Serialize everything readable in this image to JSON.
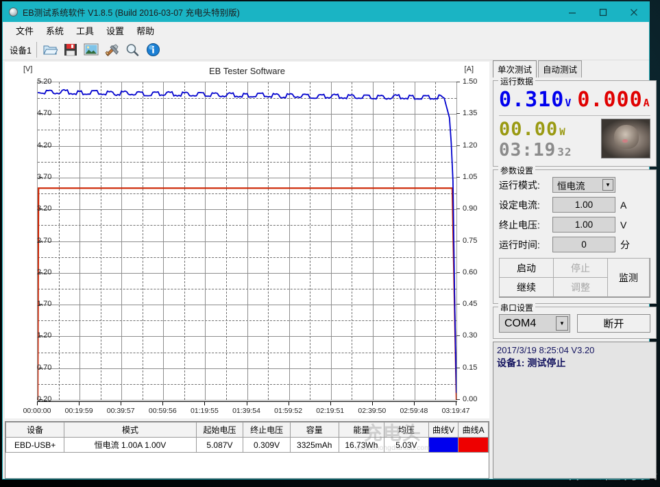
{
  "window": {
    "title": "EB测试系统软件 V1.8.5 (Build 2016-03-07 充电头特别版)",
    "app_icon": "sphere-icon",
    "minimize": "–",
    "maximize": "□",
    "close": "✕",
    "titlebar_color": "#1ab4c4"
  },
  "menubar": {
    "items": [
      {
        "label": "文件",
        "name": "menu-file"
      },
      {
        "label": "系统",
        "name": "menu-system"
      },
      {
        "label": "工具",
        "name": "menu-tools"
      },
      {
        "label": "设置",
        "name": "menu-settings"
      },
      {
        "label": "帮助",
        "name": "menu-help"
      }
    ]
  },
  "toolbar": {
    "device_label": "设备1",
    "buttons": [
      {
        "name": "open-folder-icon"
      },
      {
        "name": "save-floppy-icon"
      },
      {
        "name": "picture-icon"
      },
      {
        "name": "tools-icon"
      },
      {
        "name": "magnifier-icon"
      },
      {
        "name": "info-icon"
      }
    ]
  },
  "chart_data": {
    "type": "line",
    "title": "EB Tester Software",
    "xlabel": "",
    "ylabel": "[V]",
    "y2label": "[A]",
    "grid": true,
    "legend": "none",
    "ylim": [
      0.2,
      5.2
    ],
    "y2lim": [
      0.0,
      1.5
    ],
    "yticks": [
      "0.20",
      "0.70",
      "1.20",
      "1.70",
      "2.20",
      "2.70",
      "3.20",
      "3.70",
      "4.20",
      "4.70",
      "5.20"
    ],
    "y2ticks": [
      "0.00",
      "0.15",
      "0.30",
      "0.45",
      "0.60",
      "0.75",
      "0.90",
      "1.05",
      "1.20",
      "1.35",
      "1.50"
    ],
    "xticks": [
      "00:00:00",
      "00:19:59",
      "00:39:57",
      "00:59:56",
      "01:19:55",
      "01:39:54",
      "01:59:52",
      "02:19:51",
      "02:39:50",
      "02:59:48",
      "03:19:47"
    ],
    "xlim": [
      "00:00:00",
      "03:19:47"
    ],
    "series": [
      {
        "name": "曲线V",
        "axis": "left",
        "color": "#0000cd",
        "unit": "V",
        "description": "Voltage slowly declining with sawtooth ripple, collapsing at end of test",
        "x_pct": [
          0,
          2,
          6,
          10,
          14,
          18,
          22,
          26,
          30,
          34,
          38,
          42,
          46,
          50,
          54,
          58,
          62,
          66,
          70,
          74,
          78,
          82,
          86,
          90,
          94,
          97,
          98.5,
          99.2,
          99.6,
          100
        ],
        "values": [
          5.06,
          5.04,
          5.05,
          5.03,
          5.04,
          5.02,
          5.03,
          5.01,
          5.02,
          5.01,
          5.01,
          5.0,
          5.0,
          4.99,
          5.0,
          4.98,
          4.99,
          4.97,
          4.98,
          4.97,
          4.97,
          4.96,
          4.97,
          4.96,
          4.96,
          4.97,
          4.6,
          3.6,
          1.6,
          0.31
        ]
      },
      {
        "name": "曲线A",
        "axis": "right",
        "color": "#cc2200",
        "unit": "A",
        "description": "Constant current 1.00 A for whole run, drops to 0 at end",
        "x_pct": [
          0,
          0.2,
          1,
          50,
          98,
          99,
          99.5,
          100
        ],
        "values": [
          0.0,
          1.0,
          1.0,
          1.0,
          1.0,
          1.0,
          0.5,
          0.0
        ]
      }
    ],
    "watermark": {
      "cn": "充电头",
      "url": "www.chongdiantou.com"
    }
  },
  "results_table": {
    "headers": [
      "设备",
      "模式",
      "起始电压",
      "终止电压",
      "容量",
      "能量",
      "均压",
      "曲线V",
      "曲线A"
    ],
    "rows": [
      {
        "device": "EBD-USB+",
        "mode": "恒电流 1.00A 1.00V",
        "start_voltage": "5.087V",
        "end_voltage": "0.309V",
        "capacity": "3325mAh",
        "energy": "16.73Wh",
        "avg_voltage": "5.03V",
        "curve_v_color": "#0000ee",
        "curve_a_color": "#ee0000"
      }
    ]
  },
  "right_panel": {
    "tabs": [
      {
        "label": "单次测试",
        "active": true
      },
      {
        "label": "自动测试",
        "active": false
      }
    ],
    "running_data": {
      "group_title": "运行数据",
      "voltage_value": "0.310",
      "voltage_unit": "V",
      "voltage_color": "#0000ee",
      "current_value": "0.000",
      "current_unit": "A",
      "current_color": "#e00000",
      "power_value": "00.00",
      "power_unit": "W",
      "power_color": "#9a9a12",
      "time_value": "03:19",
      "time_seconds": "32",
      "time_color": "#8b8b8b",
      "thumbnail": "cat-photo"
    },
    "parameters": {
      "group_title": "参数设置",
      "fields": [
        {
          "label": "运行模式:",
          "value": "恒电流",
          "unit": "",
          "type": "combo"
        },
        {
          "label": "设定电流:",
          "value": "1.00",
          "unit": "A",
          "type": "text"
        },
        {
          "label": "终止电压:",
          "value": "1.00",
          "unit": "V",
          "type": "text"
        },
        {
          "label": "运行时间:",
          "value": "0",
          "unit": "分",
          "type": "text"
        }
      ],
      "buttons": [
        {
          "label": "启动",
          "enabled": true
        },
        {
          "label": "停止",
          "enabled": false
        },
        {
          "label": "继续",
          "enabled": true
        },
        {
          "label": "调整",
          "enabled": false
        },
        {
          "label": "监测",
          "enabled": true
        }
      ]
    },
    "serial": {
      "group_title": "串口设置",
      "port": "COM4",
      "disconnect_label": "断开"
    },
    "log": {
      "lines": [
        {
          "text": "2017/3/19 8:25:04  V3.20",
          "bold": false
        },
        {
          "text": "设备1: 测试停止",
          "bold": true
        }
      ]
    }
  },
  "desktop": {
    "watermark": "什么值得买"
  }
}
